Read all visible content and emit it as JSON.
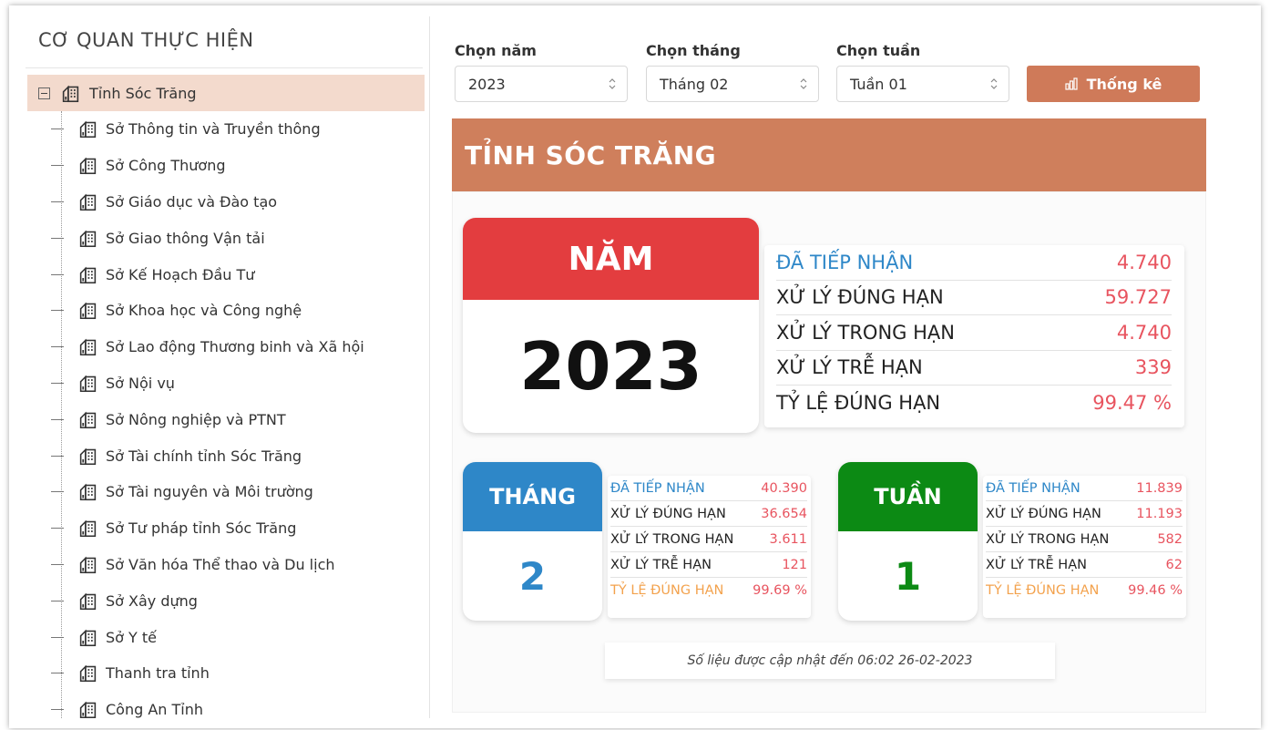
{
  "sidebar": {
    "title": "CƠ QUAN THỰC HIỆN",
    "root": {
      "label": "Tỉnh Sóc Trăng",
      "icon": "building-icon"
    },
    "items": [
      "Sở Thông tin và Truyền thông",
      "Sở Công Thương",
      "Sở Giáo dục và Đào tạo",
      "Sở Giao thông Vận tải",
      "Sở Kế Hoạch Đầu Tư",
      "Sở Khoa học và Công nghệ",
      "Sở Lao động Thương binh và Xã hội",
      "Sở Nội vụ",
      "Sở Nông nghiệp và PTNT",
      "Sở Tài chính tỉnh Sóc Trăng",
      "Sở Tài nguyên và Môi trường",
      "Sở Tư pháp tỉnh Sóc Trăng",
      "Sở Văn hóa Thể thao và Du lịch",
      "Sở Xây dựng",
      "Sở Y tế",
      "Thanh tra tỉnh",
      "Công An Tỉnh"
    ]
  },
  "filters": {
    "year": {
      "label": "Chọn năm",
      "value": "2023"
    },
    "month": {
      "label": "Chọn tháng",
      "value": "Tháng 02"
    },
    "week": {
      "label": "Chọn tuần",
      "value": "Tuần 01"
    },
    "button": {
      "label": "Thống kê",
      "icon": "bar-chart-icon"
    }
  },
  "banner": {
    "title": "TỈNH SÓC TRĂNG"
  },
  "year_card": {
    "heading": "NĂM",
    "value": "2023",
    "color": "#e33d3f",
    "stats": [
      {
        "label": "ĐÃ TIẾP NHẬN",
        "value": "4.740"
      },
      {
        "label": "XỬ LÝ ĐÚNG HẠN",
        "value": "59.727"
      },
      {
        "label": "XỬ LÝ TRONG HẠN",
        "value": "4.740"
      },
      {
        "label": "XỬ LÝ TRỄ HẠN",
        "value": "339"
      },
      {
        "label": "TỶ LỆ ĐÚNG HẠN",
        "value": "99.47 %"
      }
    ]
  },
  "month_card": {
    "heading": "THÁNG",
    "value": "2",
    "color": "#2e87c8",
    "stats": [
      {
        "label": "ĐÃ TIẾP NHẬN",
        "value": "40.390"
      },
      {
        "label": "XỬ LÝ ĐÚNG HẠN",
        "value": "36.654"
      },
      {
        "label": "XỬ LÝ TRONG HẠN",
        "value": "3.611"
      },
      {
        "label": "XỬ LÝ TRỄ HẠN",
        "value": "121"
      },
      {
        "label": "TỶ LỆ ĐÚNG HẠN",
        "value": "99.69 %"
      }
    ]
  },
  "week_card": {
    "heading": "TUẦN",
    "value": "1",
    "color": "#0c8a14",
    "stats": [
      {
        "label": "ĐÃ TIẾP NHẬN",
        "value": "11.839"
      },
      {
        "label": "XỬ LÝ ĐÚNG HẠN",
        "value": "11.193"
      },
      {
        "label": "XỬ LÝ TRONG HẠN",
        "value": "582"
      },
      {
        "label": "XỬ LÝ TRỄ HẠN",
        "value": "62"
      },
      {
        "label": "TỶ LỆ ĐÚNG HẠN",
        "value": "99.46 %"
      }
    ]
  },
  "footer": {
    "note": "Số liệu được cập nhật đến 06:02 26-02-2023"
  },
  "colors": {
    "accent": "#cf7a59",
    "selected_row": "#f3dacd",
    "value_red": "#e8545f",
    "label_blue": "#2e87c8",
    "label_orange": "#f3a24d"
  }
}
